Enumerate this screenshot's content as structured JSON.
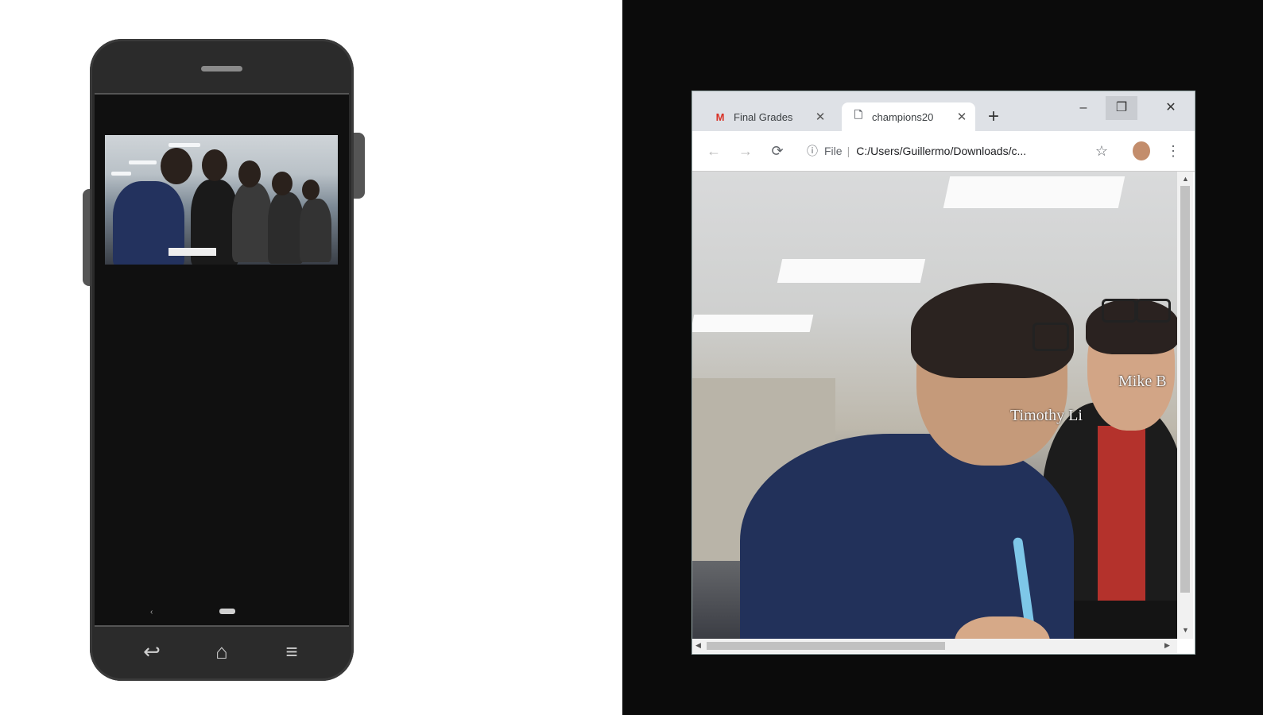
{
  "phone": {
    "nav": {
      "back": "↩",
      "home": "⌂",
      "menu": "≡",
      "small_back": "‹"
    }
  },
  "browser": {
    "tabs": [
      {
        "label": "Final Grades",
        "icon": "gmail-icon",
        "active": false
      },
      {
        "label": "champions20",
        "icon": "file-icon",
        "active": true
      }
    ],
    "new_tab": "+",
    "window_controls": {
      "minimize": "–",
      "maximize": "❐",
      "close": "✕"
    },
    "toolbar": {
      "back": "←",
      "forward": "→",
      "reload": "⟳",
      "scheme": "File",
      "url": "C:/Users/Guillermo/Downloads/c...",
      "bookmark": "☆",
      "menu": "⋮"
    },
    "content": {
      "labels": [
        "Timothy Li",
        "Mike B"
      ]
    }
  }
}
